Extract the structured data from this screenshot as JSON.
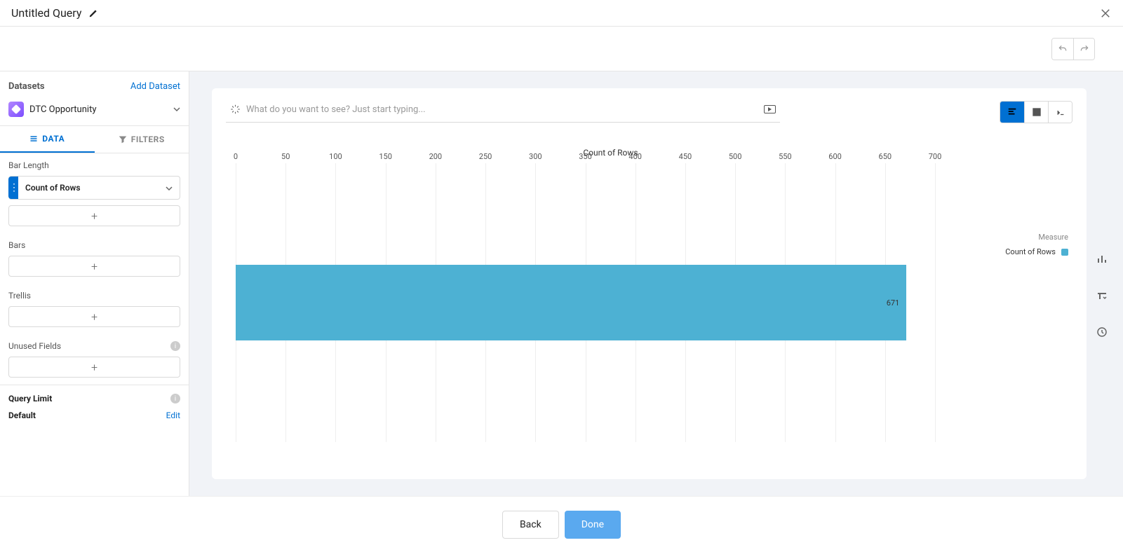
{
  "header": {
    "title": "Untitled Query"
  },
  "sidebar": {
    "datasets": {
      "title": "Datasets",
      "add_link": "Add Dataset",
      "name": "DTC Opportunity"
    },
    "tabs": {
      "data": "DATA",
      "filters": "FILTERS"
    },
    "sections": {
      "bar_length": "Bar Length",
      "bar_length_measure": "Count of Rows",
      "bars": "Bars",
      "trellis": "Trellis",
      "unused_fields": "Unused Fields"
    },
    "query_limit": {
      "title": "Query Limit",
      "default": "Default",
      "edit": "Edit"
    }
  },
  "query_input": {
    "placeholder": "What do you want to see? Just start typing..."
  },
  "chart_data": {
    "type": "bar",
    "orientation": "horizontal",
    "title": "Count of Rows",
    "categories": [
      ""
    ],
    "values": [
      671
    ],
    "xlabel": "",
    "ylabel": "",
    "xticks": [
      0,
      50,
      100,
      150,
      200,
      250,
      300,
      350,
      400,
      450,
      500,
      550,
      600,
      650,
      700
    ],
    "xlim": [
      0,
      700
    ],
    "legend": {
      "title": "Measure",
      "items": [
        "Count of Rows"
      ]
    }
  },
  "footer": {
    "back": "Back",
    "done": "Done"
  }
}
